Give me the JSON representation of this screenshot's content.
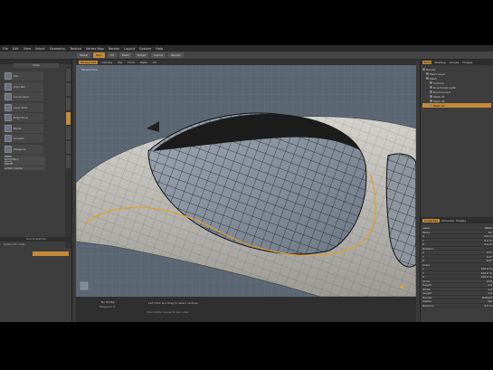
{
  "menubar": [
    "File",
    "Edit",
    "View",
    "Select",
    "Geometry",
    "Texture",
    "Vertex Map",
    "Render",
    "Layout",
    "System",
    "Help"
  ],
  "toolbar": {
    "buttons": [
      {
        "label": "Model",
        "active": false
      },
      {
        "label": "Topo",
        "active": true
      },
      {
        "label": "UV",
        "active": false
      },
      {
        "label": "Paint",
        "active": false
      },
      {
        "label": "Sculpt",
        "active": false
      },
      {
        "label": "Layout",
        "active": false
      },
      {
        "label": "Render",
        "active": false
      }
    ]
  },
  "left_panel": {
    "title": "Tools",
    "tools": [
      "Pen",
      "Topo Pen",
      "Curve Slice",
      "Loop Slice",
      "Edge Slice",
      "Bevel",
      "Smooth",
      "Polygons",
      "Slide"
    ],
    "tool_ui_items": [
      "Symmetry",
      "Falloff",
      "Action Center"
    ],
    "bottom_label": "Tool Properties",
    "bottom_row": "Action Ctr: Auto"
  },
  "viewport": {
    "tabs": [
      "Perspective",
      "Camera",
      "Top",
      "Front",
      "Right",
      "UV"
    ],
    "label": "Perspective"
  },
  "status": {
    "left_line1": "No Tooltip",
    "left_line2": "Polygons: 0",
    "center_line1": "Left Click and drag to select vertices",
    "center_line2": "Use middle mouse to pan view"
  },
  "right_panel": {
    "tabs": [
      "Items",
      "Shading",
      "Groups",
      "Images"
    ],
    "items": [
      "Render",
      "Mesh Layer",
      "Mesh",
      "Camera",
      "Directional Light",
      "Environment",
      "Mesh 01",
      "Mesh 02",
      "Mesh 03"
    ],
    "selected_item": "Mesh 03",
    "props_tabs": [
      "Properties",
      "Channels",
      "Display"
    ],
    "props": [
      {
        "k": "Label",
        "v": "Mesh"
      },
      {
        "k": "Mode",
        "v": "On"
      },
      {
        "k": "X",
        "v": "0.0 m"
      },
      {
        "k": "Y",
        "v": "0.0 m"
      },
      {
        "k": "Z",
        "v": "0.0 m"
      },
      {
        "k": "Rotation",
        "v": ""
      },
      {
        "k": "X",
        "v": "0.0°"
      },
      {
        "k": "Y",
        "v": "0.0°"
      },
      {
        "k": "Z",
        "v": "0.0°"
      },
      {
        "k": "Scale",
        "v": ""
      },
      {
        "k": "X",
        "v": "100.0 %"
      },
      {
        "k": "Y",
        "v": "100.0 %"
      },
      {
        "k": "Z",
        "v": "100.0 %"
      },
      {
        "k": "Order",
        "v": "XYZ"
      },
      {
        "k": "Height",
        "v": "1.0"
      },
      {
        "k": "Width",
        "v": "1.0"
      },
      {
        "k": "Length",
        "v": "1.0"
      },
      {
        "k": "Render",
        "v": "Default"
      },
      {
        "k": "Visible",
        "v": "Yes"
      },
      {
        "k": "Dissolve",
        "v": "0.0 %"
      }
    ]
  },
  "colors": {
    "accent": "#c48a3a",
    "viewport_bg": "#5b6673",
    "surface": "#b8b6b0",
    "wire": "#1a1a1a",
    "highlight_curve": "#e0a030"
  }
}
